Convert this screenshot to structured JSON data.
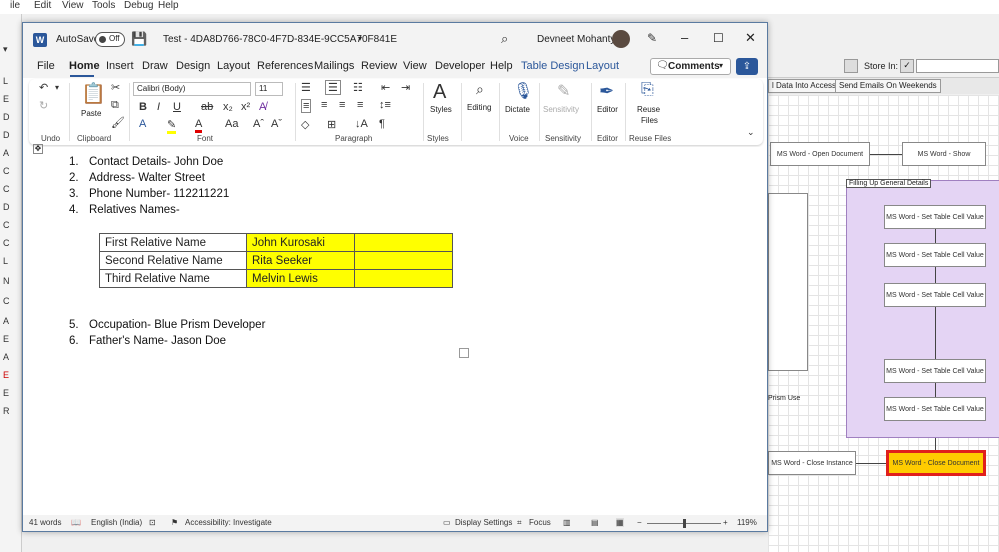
{
  "background_app": {
    "menu": [
      "ile",
      "Edit",
      "View",
      "Tools",
      "Debug",
      "Help"
    ],
    "store_in_label": "Store In:",
    "tabs": [
      "l Data Into Access",
      "Send Emails On Weekends"
    ],
    "block_label": "Filling Up General Details",
    "stages": {
      "open_document": "MS Word - Open Document",
      "show": "MS Word - Show",
      "set_cell_1": "MS Word - Set Table Cell Value",
      "set_cell_2": "MS Word - Set Table Cell Value",
      "set_cell_3": "MS Word - Set Table Cell Value",
      "set_cell_4": "MS Word - Set Table Cell Value",
      "set_cell_5": "MS Word - Set Table Cell Value",
      "close_document": "MS Word - Close Document",
      "close_instance": "MS Word - Close Instance",
      "prism_use": "Prism Use"
    }
  },
  "word": {
    "autosave_label": "AutoSave",
    "autosave_state": "Off",
    "doc_title": "Test  -  4DA8D766-78C0-4F7D-834E-9CC5A70F841E",
    "user_name": "Devneet Mohanty",
    "menu": {
      "file": "File",
      "home": "Home",
      "insert": "Insert",
      "draw": "Draw",
      "design": "Design",
      "layout": "Layout",
      "references": "References",
      "mailings": "Mailings",
      "review": "Review",
      "view": "View",
      "developer": "Developer",
      "help": "Help",
      "table_design": "Table Design",
      "table_layout": "Layout"
    },
    "comments_label": "Comments",
    "ribbon": {
      "paste": "Paste",
      "font_name": "Calibri (Body)",
      "font_size": "11",
      "styles": "Styles",
      "editing": "Editing",
      "dictate": "Dictate",
      "sensitivity": "Sensitivity",
      "editor": "Editor",
      "reuse_files_1": "Reuse",
      "reuse_files_2": "Files",
      "groups": {
        "undo": "Undo",
        "clipboard": "Clipboard",
        "font": "Font",
        "paragraph": "Paragraph",
        "styles": "Styles",
        "voice": "Voice",
        "sensitivity": "Sensitivity",
        "editor": "Editor",
        "reuse_files": "Reuse Files"
      }
    },
    "document": {
      "list_top": [
        {
          "num": "1.",
          "text": "Contact Details- John Doe"
        },
        {
          "num": "2.",
          "text": "Address- Walter Street"
        },
        {
          "num": "3.",
          "text": "Phone Number- 112211221"
        },
        {
          "num": "4.",
          "text": "Relatives Names-"
        }
      ],
      "table": [
        {
          "label": "First Relative Name",
          "value": "John Kurosaki"
        },
        {
          "label": "Second Relative Name",
          "value": "Rita Seeker"
        },
        {
          "label": "Third Relative Name",
          "value": "Melvin Lewis"
        }
      ],
      "list_bottom": [
        {
          "num": "5.",
          "text": "Occupation- Blue Prism Developer"
        },
        {
          "num": "6.",
          "text": "Father's Name- Jason Doe"
        }
      ]
    },
    "status": {
      "words": "41 words",
      "language": "English (India)",
      "accessibility": "Accessibility: Investigate",
      "display_settings": "Display Settings",
      "focus": "Focus",
      "zoom": "119%"
    }
  }
}
